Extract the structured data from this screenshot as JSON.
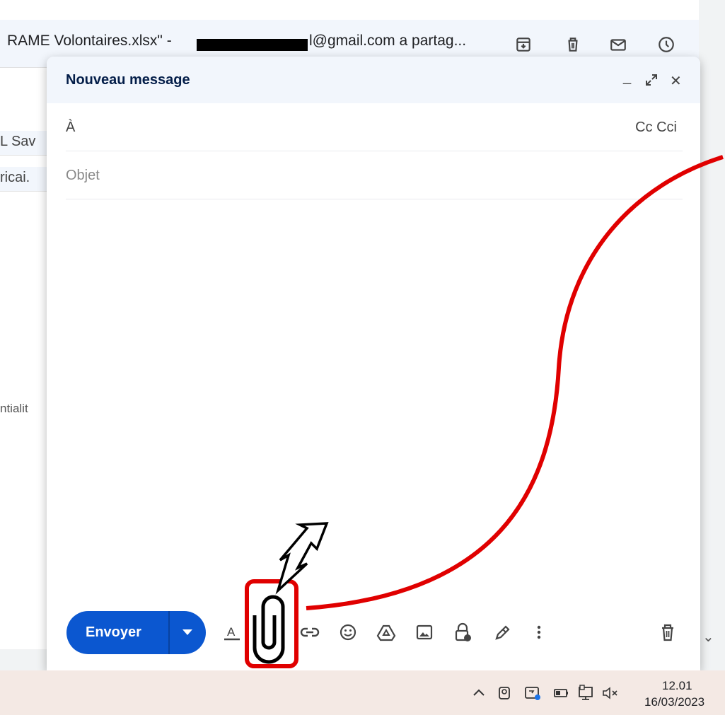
{
  "background": {
    "subject_prefix": "RAME Volontaires.xlsx\" -",
    "subject_suffix": "l@gmail.com a partag...",
    "row1": "L Sav",
    "row2": "ricai.",
    "body_fragment": "ntialit",
    "header_icons": [
      "archive-icon",
      "trash-icon",
      "mail-icon",
      "clock-icon"
    ]
  },
  "compose": {
    "title": "Nouveau message",
    "controls": {
      "minimize": "_",
      "expand": "expand-icon",
      "close": "✕"
    },
    "to_label": "À",
    "cc_label": "Cc Cci",
    "subject_placeholder": "Objet",
    "send_label": "Envoyer",
    "accent_color": "#0b57d0",
    "toolbar_icons": [
      "format-text-icon",
      "paperclip-icon",
      "link-icon",
      "emoji-icon",
      "drive-icon",
      "image-icon",
      "lock-clock-icon",
      "pen-icon",
      "more-vert-icon",
      "trash-icon"
    ]
  },
  "annotation": {
    "color": "#e00000",
    "target": "paperclip-icon"
  },
  "taskbar": {
    "time": "12.01",
    "date": "16/03/2023",
    "tray_icons": [
      "chevron-up-icon",
      "camera-icon",
      "cast-icon",
      "battery-icon",
      "network-icon",
      "volume-muted-icon"
    ]
  }
}
